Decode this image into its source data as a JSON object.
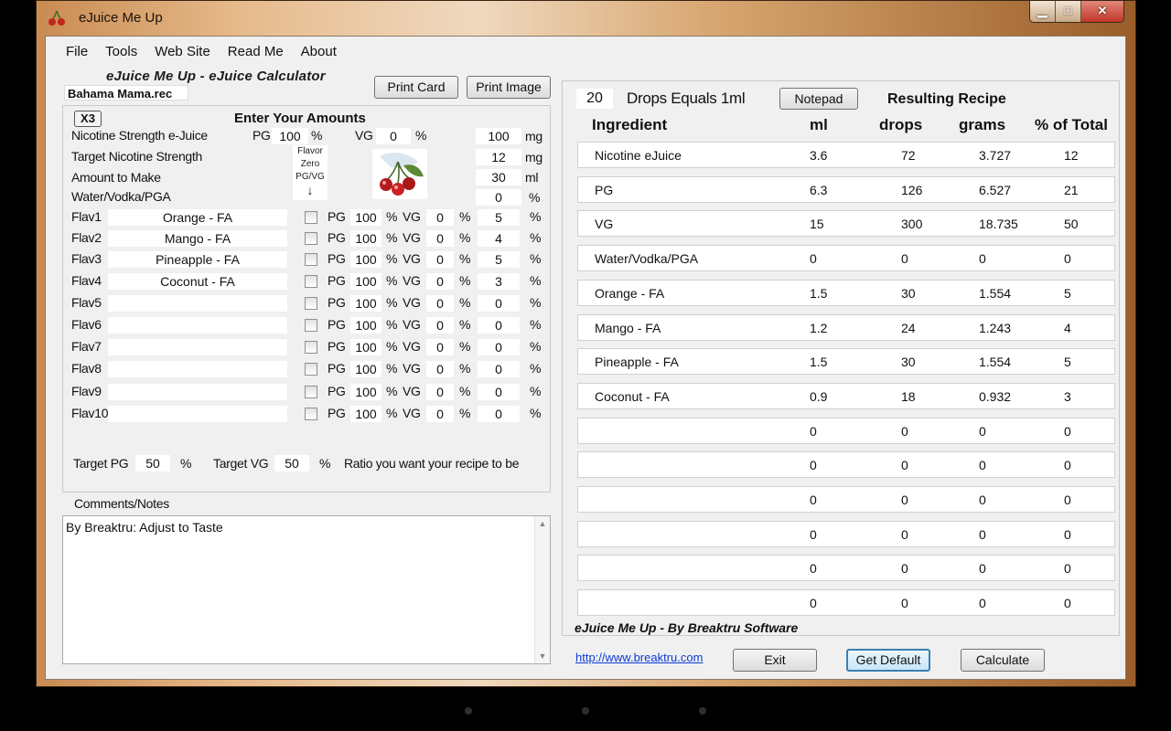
{
  "window": {
    "title": "eJuice Me Up",
    "minimize": "▁",
    "maximize": "□",
    "close": "✕",
    "icon": "cherry-icon"
  },
  "menu": [
    "File",
    "Tools",
    "Web Site",
    "Read Me",
    "About"
  ],
  "app_title": "eJuice Me Up - eJuice Calculator",
  "filename": "Bahama Mama.rec",
  "buttons": {
    "print_card": "Print Card",
    "print_image": "Print Image",
    "notepad": "Notepad",
    "exit": "Exit",
    "get_default": "Get Default",
    "calculate": "Calculate"
  },
  "amounts": {
    "x3": "X3",
    "heading": "Enter Your Amounts",
    "nicotine_label": "Nicotine Strength e-Juice",
    "nicotine_pg_label": "PG",
    "nicotine_pg": "100",
    "nicotine_vg_label": "VG",
    "nicotine_vg": "0",
    "pct": "%",
    "nicotine_value": "100",
    "unit_mg": "mg",
    "target_label": "Target Nicotine Strength",
    "target_value": "12",
    "amount_label": "Amount to Make",
    "amount_value": "30",
    "unit_ml": "ml",
    "water_label": "Water/Vodka/PGA",
    "water_value": "0",
    "zero_label": [
      "Flavor",
      "Zero",
      "PG/VG",
      "↓"
    ]
  },
  "flavors": [
    {
      "label": "Flav1",
      "name": "Orange - FA",
      "pg": "100",
      "vg": "0",
      "pct": "5"
    },
    {
      "label": "Flav2",
      "name": "Mango - FA",
      "pg": "100",
      "vg": "0",
      "pct": "4"
    },
    {
      "label": "Flav3",
      "name": "Pineapple - FA",
      "pg": "100",
      "vg": "0",
      "pct": "5"
    },
    {
      "label": "Flav4",
      "name": "Coconut - FA",
      "pg": "100",
      "vg": "0",
      "pct": "3"
    },
    {
      "label": "Flav5",
      "name": "",
      "pg": "100",
      "vg": "0",
      "pct": "0"
    },
    {
      "label": "Flav6",
      "name": "",
      "pg": "100",
      "vg": "0",
      "pct": "0"
    },
    {
      "label": "Flav7",
      "name": "",
      "pg": "100",
      "vg": "0",
      "pct": "0"
    },
    {
      "label": "Flav8",
      "name": "",
      "pg": "100",
      "vg": "0",
      "pct": "0"
    },
    {
      "label": "Flav9",
      "name": "",
      "pg": "100",
      "vg": "0",
      "pct": "0"
    },
    {
      "label": "Flav10",
      "name": "",
      "pg": "100",
      "vg": "0",
      "pct": "0"
    }
  ],
  "flavor_labels": {
    "pg": "PG",
    "vg": "VG",
    "pct": "%"
  },
  "target_ratio": {
    "pg_label": "Target PG",
    "pg": "50",
    "vg_label": "Target VG",
    "vg": "50",
    "pct": "%",
    "note": "Ratio you want your recipe to be"
  },
  "notes": {
    "label": "Comments/Notes",
    "text": "By Breaktru: Adjust to Taste"
  },
  "recipe": {
    "drops_value": "20",
    "drops_label": "Drops Equals 1ml",
    "heading": "Resulting Recipe",
    "columns": [
      "Ingredient",
      "ml",
      "drops",
      "grams",
      "% of Total"
    ],
    "rows": [
      [
        "Nicotine eJuice",
        "3.6",
        "72",
        "3.727",
        "12"
      ],
      [
        "PG",
        "6.3",
        "126",
        "6.527",
        "21"
      ],
      [
        "VG",
        "15",
        "300",
        "18.735",
        "50"
      ],
      [
        "Water/Vodka/PGA",
        "0",
        "0",
        "0",
        "0"
      ],
      [
        "Orange - FA",
        "1.5",
        "30",
        "1.554",
        "5"
      ],
      [
        "Mango - FA",
        "1.2",
        "24",
        "1.243",
        "4"
      ],
      [
        "Pineapple - FA",
        "1.5",
        "30",
        "1.554",
        "5"
      ],
      [
        "Coconut - FA",
        "0.9",
        "18",
        "0.932",
        "3"
      ],
      [
        "",
        "0",
        "0",
        "0",
        "0"
      ],
      [
        "",
        "0",
        "0",
        "0",
        "0"
      ],
      [
        "",
        "0",
        "0",
        "0",
        "0"
      ],
      [
        "",
        "0",
        "0",
        "0",
        "0"
      ],
      [
        "",
        "0",
        "0",
        "0",
        "0"
      ],
      [
        "",
        "0",
        "0",
        "0",
        "0"
      ]
    ]
  },
  "footer": {
    "credit": "eJuice Me Up -  By Breaktru Software",
    "link": "http://www.breaktru.com"
  },
  "icons": {
    "scroll_up": "▲",
    "scroll_down": "▼"
  }
}
